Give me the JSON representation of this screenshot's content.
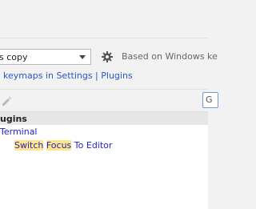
{
  "keymap": {
    "selected": "s copy",
    "based_on": "Based on Windows ke"
  },
  "settings_link": "keymaps in Settings | Plugins",
  "search": {
    "value": "G"
  },
  "tree": {
    "header": "ugins",
    "items": [
      {
        "label": "Terminal"
      },
      {
        "action": {
          "part1": "Switch",
          "space1": " ",
          "part2": "Focus",
          "part3": " To Editor"
        }
      }
    ]
  }
}
